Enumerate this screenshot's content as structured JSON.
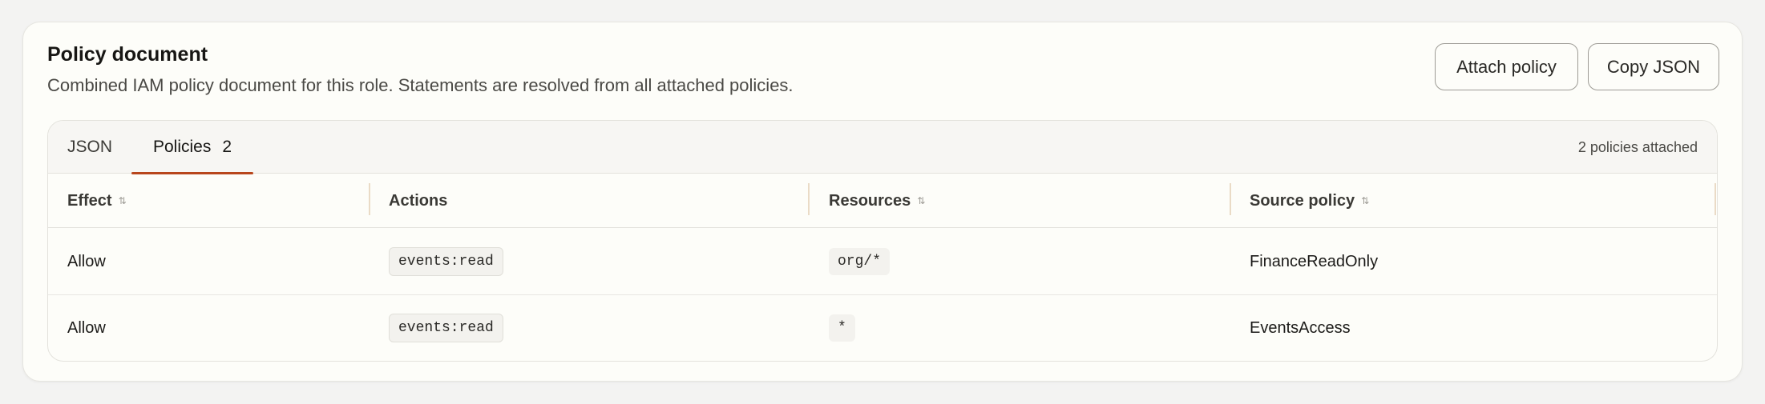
{
  "header": {
    "title": "Policy document",
    "subtitle": "Combined IAM policy document for this role. Statements are resolved from all attached policies."
  },
  "actions": {
    "attach_label": "Attach policy",
    "copy_label": "Copy JSON"
  },
  "tabs": [
    {
      "label": "JSON",
      "count": "",
      "active": false
    },
    {
      "label": "Policies",
      "count": "2",
      "active": true
    }
  ],
  "attached_summary": "2 policies attached",
  "table": {
    "columns": [
      {
        "label": "Effect",
        "sortable": true
      },
      {
        "label": "Actions",
        "sortable": false
      },
      {
        "label": "Resources",
        "sortable": true
      },
      {
        "label": "Source policy",
        "sortable": true
      }
    ],
    "rows": [
      {
        "effect": "Allow",
        "action": "events:read",
        "resource": "org/*",
        "source": "FinanceReadOnly"
      },
      {
        "effect": "Allow",
        "action": "events:read",
        "resource": "*",
        "source": "EventsAccess"
      }
    ]
  },
  "colors": {
    "accent": "#b8461c",
    "background": "#fdfdf9"
  }
}
